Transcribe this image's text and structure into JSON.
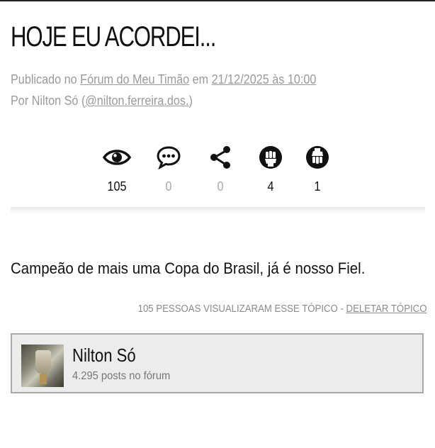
{
  "post": {
    "title": "HOJE EU ACORDEI...",
    "published_prefix": "Publicado no ",
    "forum_link": "Fórum do Meu Timão",
    "date_prefix": " em ",
    "date_link": "21/12/2025 às 10:00",
    "author_prefix": "Por Nilton Só (",
    "author_handle": "@nilton.ferreira.dos.",
    "author_suffix": ")",
    "body": "Campeão de mais uma Copa do Brasil, já é nosso Fiel."
  },
  "stats": [
    {
      "icon": "eye-icon",
      "count": "105"
    },
    {
      "icon": "comment-icon",
      "count": "0"
    },
    {
      "icon": "share-icon",
      "count": "0"
    },
    {
      "icon": "fist-icon",
      "count": "4"
    },
    {
      "icon": "fist-down-icon",
      "count": "1"
    }
  ],
  "footer": {
    "views_text": "105 PESSOAS VISUALIZARAM ESSE TÓPICO - ",
    "delete_link": "DELETAR TÓPICO"
  },
  "author_card": {
    "name": "Nilton Só",
    "posts": "4.295 posts no fórum"
  },
  "colors": {
    "text": "#111111",
    "muted": "#9a9a9a",
    "card_bg": "#ececec",
    "card_border": "#a9a9a9"
  }
}
